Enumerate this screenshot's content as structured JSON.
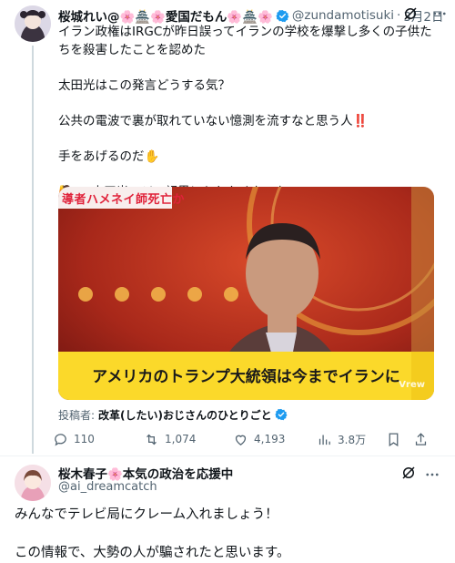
{
  "tweet": {
    "display_name": "桜城れい@🌸🏯🌸愛国だもん🌸🏯🌸",
    "handle": "@zundamotisuki",
    "separator": "·",
    "date": "3月2日",
    "text": "イラン政権はIRGCが昨日誤ってイランの学校を爆撃し多くの子供たちを殺害したことを認めた\n\n太田光はこの発言どうする気？\n\n公共の電波で裏が取れていない憶測を流すなと思う人‼️\n\n手をあげるのだ✋\n\n🙋 < 太田光マジで視界に入れたくないわ",
    "media": {
      "banner_text": "導者ハメネイ師死亡か",
      "caption": "アメリカのトランプ大統領は今までイランに",
      "watermark": "Vrew"
    },
    "poster_label": "投稿者:",
    "poster_name": "改革(したい)おじさんのひとりごと",
    "stats": {
      "replies": "110",
      "reposts": "1,074",
      "likes": "4,193",
      "views": "3.8万"
    },
    "colors": {
      "verified": "#1d9bf0",
      "text": "#0f1419",
      "muted": "#536471"
    }
  },
  "reply": {
    "display_name": "桜木春子🌸本気の政治を応援中",
    "handle": "@ai_dreamcatch",
    "text": "みんなでテレビ局にクレーム入れましょう！\n\nこの情報で、大勢の人が騙されたと思います。"
  }
}
